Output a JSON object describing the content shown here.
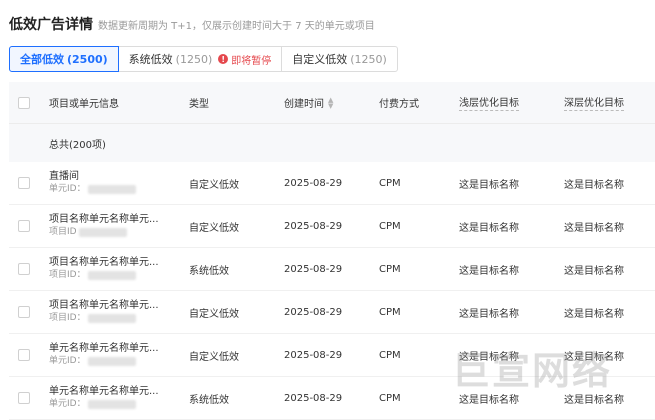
{
  "header": {
    "title": "低效广告详情",
    "subtitle": "数据更新周期为 T+1，仅展示创建时间大于 7 天的单元或项目"
  },
  "tabs": [
    {
      "label": "全部低效",
      "count": "(2500)",
      "active": true
    },
    {
      "label": "系统低效",
      "count": "(1250)",
      "warning": "即将暂停"
    },
    {
      "label": "自定义低效",
      "count": "(1250)"
    }
  ],
  "columns": {
    "name": "项目或单元信息",
    "type": "类型",
    "time": "创建时间",
    "pay": "付费方式",
    "shallow": "浅层优化目标",
    "deep": "深层优化目标"
  },
  "summary": "总共(200项)",
  "rows": [
    {
      "name": "直播间",
      "id_label": "单元ID：",
      "type": "自定义低效",
      "time": "2025-08-29",
      "pay": "CPM",
      "shallow": "这是目标名称",
      "deep": "这是目标名称"
    },
    {
      "name": "项目名称单元名称单元...",
      "id_label": "项目ID",
      "type": "自定义低效",
      "time": "2025-08-29",
      "pay": "CPM",
      "shallow": "这是目标名称",
      "deep": "这是目标名称"
    },
    {
      "name": "项目名称单元名称单元...",
      "id_label": "项目ID：",
      "type": "系统低效",
      "time": "2025-08-29",
      "pay": "CPM",
      "shallow": "这是目标名称",
      "deep": "这是目标名称"
    },
    {
      "name": "项目名称单元名称单元...",
      "id_label": "项目ID：",
      "type": "自定义低效",
      "time": "2025-08-29",
      "pay": "CPM",
      "shallow": "这是目标名称",
      "deep": "这是目标名称"
    },
    {
      "name": "单元名称单元名称单元...",
      "id_label": "单元ID：",
      "type": "自定义低效",
      "time": "2025-08-29",
      "pay": "CPM",
      "shallow": "这是目标名称",
      "deep": "这是目标名称"
    },
    {
      "name": "单元名称单元名称单元...",
      "id_label": "单元ID：",
      "type": "系统低效",
      "time": "2025-08-29",
      "pay": "CPM",
      "shallow": "这是目标名称",
      "deep": "这是目标名称"
    }
  ],
  "watermark": "巨宣网络",
  "colors": {
    "accent": "#1e6fff",
    "warning": "#e5484d"
  }
}
